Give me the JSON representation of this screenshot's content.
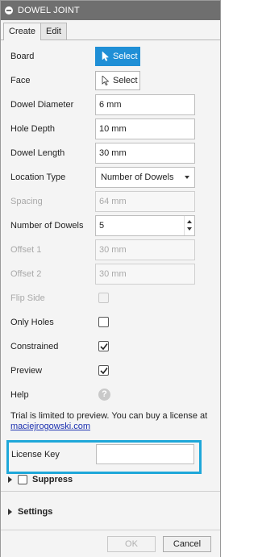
{
  "window": {
    "title": "DOWEL JOINT"
  },
  "tabs": [
    {
      "label": "Create",
      "active": true
    },
    {
      "label": "Edit",
      "active": false
    }
  ],
  "fields": {
    "board": {
      "label": "Board",
      "button": "Select",
      "active": true
    },
    "face": {
      "label": "Face",
      "button": "Select",
      "active": false
    },
    "dowel_diameter": {
      "label": "Dowel Diameter",
      "value": "6 mm"
    },
    "hole_depth": {
      "label": "Hole Depth",
      "value": "10 mm"
    },
    "dowel_length": {
      "label": "Dowel Length",
      "value": "30 mm"
    },
    "location_type": {
      "label": "Location Type",
      "selected": "Number of Dowels"
    },
    "spacing": {
      "label": "Spacing",
      "value": "64 mm",
      "disabled": true
    },
    "number_of_dowels": {
      "label": "Number of Dowels",
      "value": "5"
    },
    "offset1": {
      "label": "Offset 1",
      "value": "30 mm",
      "disabled": true
    },
    "offset2": {
      "label": "Offset 2",
      "value": "30 mm",
      "disabled": true
    },
    "flip_side": {
      "label": "Flip Side",
      "checked": false,
      "disabled": true
    },
    "only_holes": {
      "label": "Only Holes",
      "checked": false
    },
    "constrained": {
      "label": "Constrained",
      "checked": true
    },
    "preview": {
      "label": "Preview",
      "checked": true
    },
    "help": {
      "label": "Help",
      "icon_text": "?"
    }
  },
  "trial": {
    "text": "Trial is limited to preview. You can buy a license at ",
    "link": "maciejrogowski.com"
  },
  "license": {
    "label": "License Key",
    "value": ""
  },
  "groups": {
    "suppress": {
      "label": "Suppress"
    },
    "settings": {
      "label": "Settings"
    }
  },
  "footer": {
    "ok": "OK",
    "cancel": "Cancel"
  },
  "colors": {
    "accent": "#1f8fd6",
    "highlight": "#1ea7d9",
    "titlebar": "#6f6f6f"
  }
}
